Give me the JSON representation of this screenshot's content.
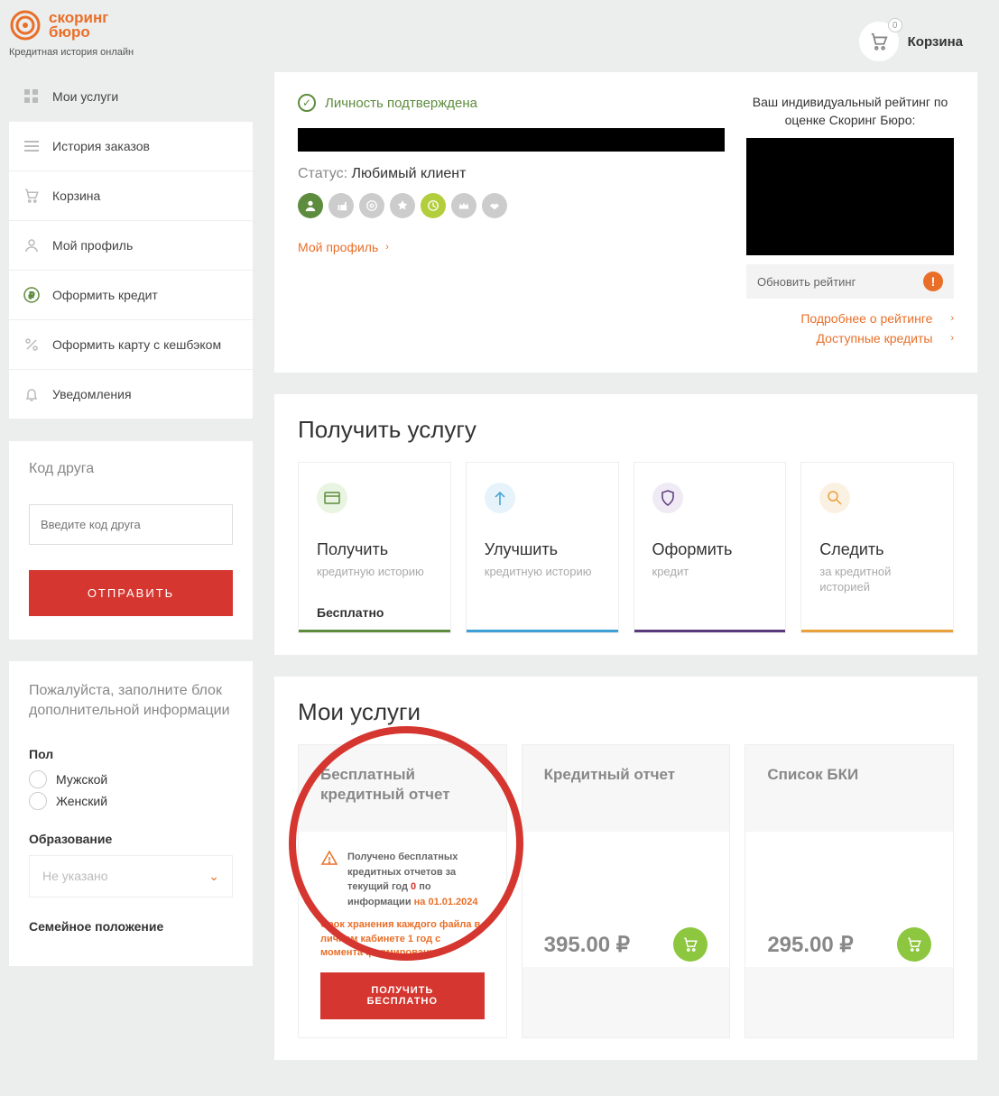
{
  "header": {
    "logo_line1": "скоринг",
    "logo_line2": "бюро",
    "tagline": "Кредитная история онлайн",
    "cart_count": "0",
    "cart_label": "Корзина"
  },
  "sidebar": {
    "items": [
      {
        "label": "Мои услуги"
      },
      {
        "label": "История заказов"
      },
      {
        "label": "Корзина"
      },
      {
        "label": "Мой профиль"
      },
      {
        "label": "Оформить кредит"
      },
      {
        "label": "Оформить карту с кешбэком"
      },
      {
        "label": "Уведомления"
      }
    ]
  },
  "friend_code": {
    "title": "Код друга",
    "placeholder": "Введите код друга",
    "submit": "ОТПРАВИТЬ"
  },
  "extra_info": {
    "prompt": "Пожалуйста, заполните блок дополнительной информации",
    "gender_label": "Пол",
    "gender_m": "Мужской",
    "gender_f": "Женский",
    "education_label": "Образование",
    "education_placeholder": "Не указано",
    "marital_label": "Семейное положение"
  },
  "profile": {
    "verified": "Личность подтверждена",
    "status_label": "Статус: ",
    "status_value": "Любимый клиент",
    "my_profile_link": "Мой профиль"
  },
  "rating": {
    "title": "Ваш индивидуальный рейтинг по оценке Скоринг Бюро:",
    "update": "Обновить рейтинг",
    "more": "Подробнее о рейтинге",
    "credits": "Доступные кредиты"
  },
  "services": {
    "heading": "Получить услугу",
    "cards": [
      {
        "title": "Получить",
        "sub": "кредитную историю",
        "foot": "Бесплатно",
        "color": "#5e8c3e",
        "icon_bg": "#e9f4e2"
      },
      {
        "title": "Улучшить",
        "sub": "кредитную историю",
        "foot": "",
        "color": "#3ea0d6",
        "icon_bg": "#e6f3fa"
      },
      {
        "title": "Оформить",
        "sub": "кредит",
        "foot": "",
        "color": "#5a3a7a",
        "icon_bg": "#f0eaf5"
      },
      {
        "title": "Следить",
        "sub": "за кредитной историей",
        "foot": "",
        "color": "#e9a13c",
        "icon_bg": "#fbf1e2"
      }
    ]
  },
  "my_services": {
    "heading": "Мои услуги",
    "free_report": {
      "title": "Бесплатный кредитный отчет",
      "info_pre": "Получено бесплатных кредитных отчетов за текущий год ",
      "zero": "0",
      "info_mid": " по информации ",
      "date": "на 01.01.2024",
      "storage": "Срок хранения каждого файла в личном кабинете 1 год с момента формирования",
      "button": "ПОЛУЧИТЬ БЕСПЛАТНО"
    },
    "credit_report": {
      "title": "Кредитный отчет",
      "price": "395.00 ₽"
    },
    "bki_list": {
      "title": "Список БКИ",
      "price": "295.00 ₽"
    }
  }
}
